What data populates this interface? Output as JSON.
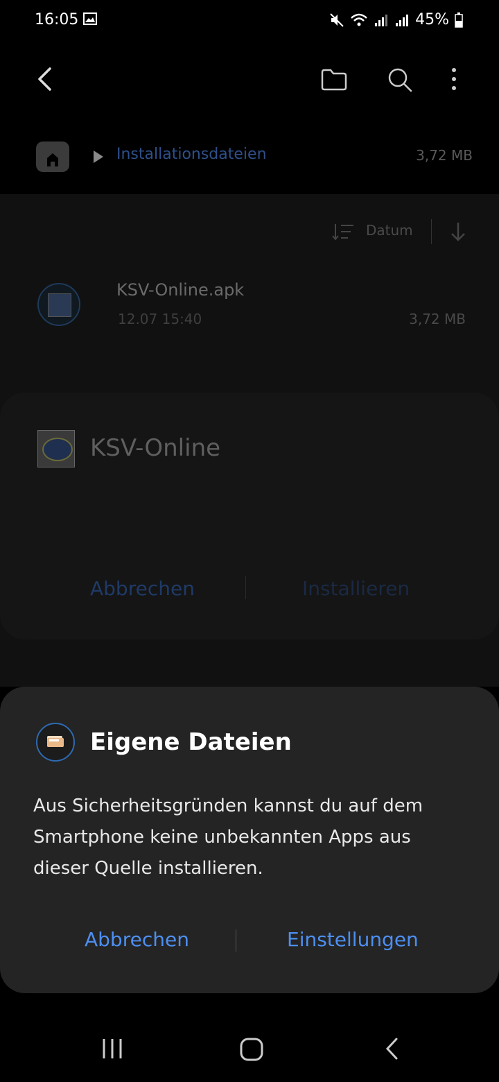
{
  "status_bar": {
    "time": "16:05",
    "battery": "45%",
    "icons": [
      "gallery-icon",
      "mute-icon",
      "wifi-icon",
      "signal-icon",
      "battery-icon"
    ]
  },
  "toolbar": {
    "icons": [
      "back-arrow-icon",
      "folder-icon",
      "search-icon",
      "more-options-icon"
    ]
  },
  "path_bar": {
    "current_folder": "Installationsdateien",
    "size": "3,72 MB"
  },
  "sort": {
    "label": "Datum"
  },
  "files": [
    {
      "name": "KSV-Online.apk",
      "date": "12.07 15:40",
      "size": "3,72 MB"
    }
  ],
  "install_sheet": {
    "app_name": "KSV-Online",
    "cancel_label": "Abbrechen",
    "install_label": "Installieren"
  },
  "dialog": {
    "title": "Eigene Dateien",
    "message": "Aus Sicherheitsgründen kannst du auf dem Smartphone keine unbekannten Apps aus dieser Quelle installieren.",
    "cancel_label": "Abbrechen",
    "settings_label": "Einstellungen",
    "accent": "#4d8ff0"
  }
}
